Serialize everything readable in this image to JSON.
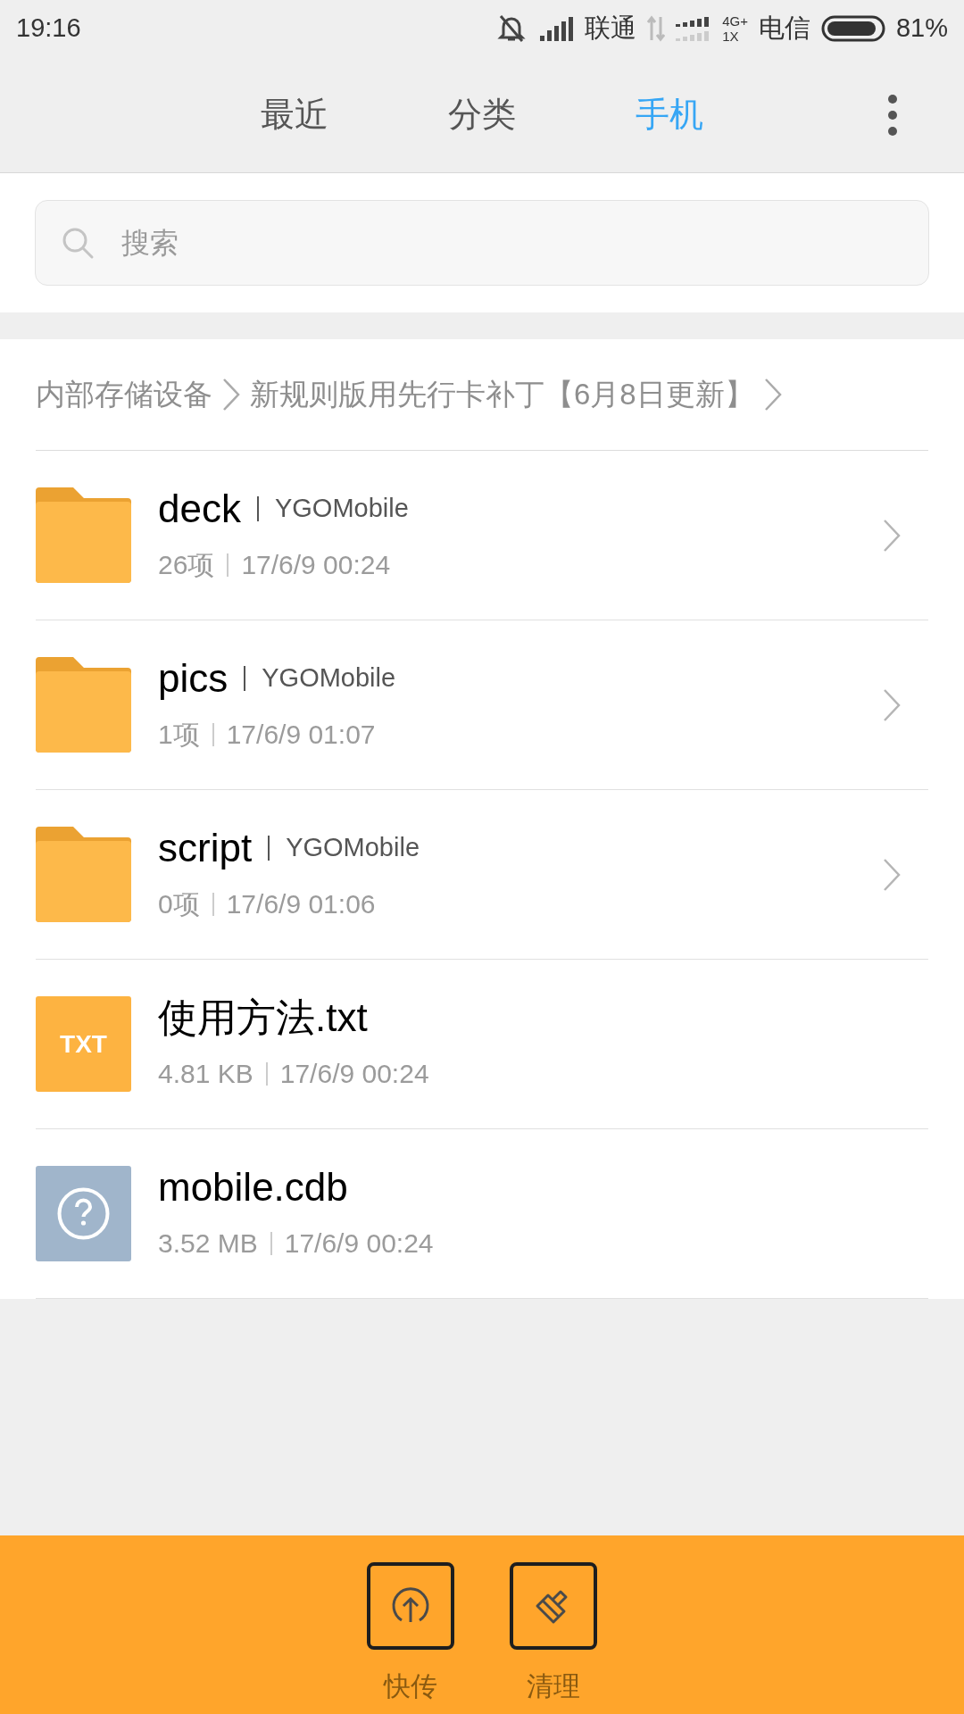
{
  "status_bar": {
    "time": "19:16",
    "carrier_1": "联通",
    "network_top": "4G+",
    "network_bottom": "1X",
    "carrier_2": "电信",
    "battery": "81%"
  },
  "tabs": [
    {
      "label": "最近",
      "selected": false
    },
    {
      "label": "分类",
      "selected": false
    },
    {
      "label": "手机",
      "selected": true
    }
  ],
  "search": {
    "placeholder": "搜索"
  },
  "breadcrumb": [
    "内部存储设备",
    "新规则版用先行卡补丁【6月8日更新】"
  ],
  "files": [
    {
      "kind": "folder",
      "name": "deck",
      "tag": "YGOMobile",
      "info": "26项",
      "date": "17/6/9 00:24"
    },
    {
      "kind": "folder",
      "name": "pics",
      "tag": "YGOMobile",
      "info": "1项",
      "date": "17/6/9 01:07"
    },
    {
      "kind": "folder",
      "name": "script",
      "tag": "YGOMobile",
      "info": "0项",
      "date": "17/6/9 01:06"
    },
    {
      "kind": "txt",
      "name": "使用方法.txt",
      "icon_label": "TXT",
      "info": "4.81 KB",
      "date": "17/6/9 00:24"
    },
    {
      "kind": "unknown",
      "name": "mobile.cdb",
      "info": "3.52 MB",
      "date": "17/6/9 00:24"
    }
  ],
  "bottom_actions": [
    {
      "kind": "send",
      "label": "快传"
    },
    {
      "kind": "clean",
      "label": "清理"
    }
  ]
}
